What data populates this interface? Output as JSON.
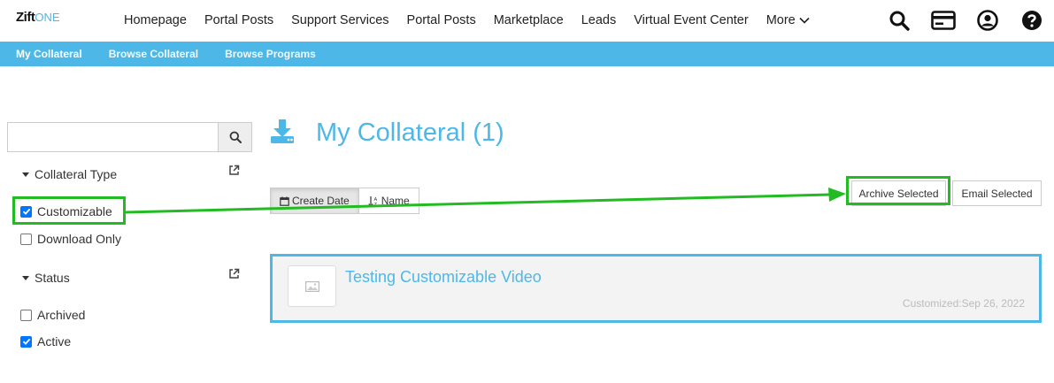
{
  "brand": {
    "name": "Zift",
    "suffix": "ONE"
  },
  "nav": {
    "items": [
      "Homepage",
      "Portal Posts",
      "Support Services",
      "Portal Posts",
      "Marketplace",
      "Leads",
      "Virtual Event Center"
    ],
    "more_label": "More"
  },
  "icons": [
    "search-icon",
    "card-icon",
    "user-icon",
    "help-icon"
  ],
  "subnav": {
    "items": [
      "My Collateral",
      "Browse Collateral",
      "Browse Programs"
    ]
  },
  "sidebar": {
    "search": {
      "value": "",
      "placeholder": ""
    },
    "collateral_type": {
      "heading": "Collateral Type",
      "options": [
        {
          "label": "Customizable",
          "checked": true
        },
        {
          "label": "Download Only",
          "checked": false
        }
      ]
    },
    "status": {
      "heading": "Status",
      "options": [
        {
          "label": "Archived",
          "checked": false
        },
        {
          "label": "Active",
          "checked": true
        }
      ]
    }
  },
  "main": {
    "title": "My Collateral (1)",
    "sort": {
      "create_date": "Create Date",
      "name": "Name"
    },
    "actions": {
      "archive": "Archive Selected",
      "email": "Email Selected"
    },
    "items": [
      {
        "title": "Testing Customizable Video",
        "meta": "Customized:Sep 26, 2022"
      }
    ]
  },
  "colors": {
    "accent": "#4db8e8",
    "highlight": "#22bb22"
  }
}
